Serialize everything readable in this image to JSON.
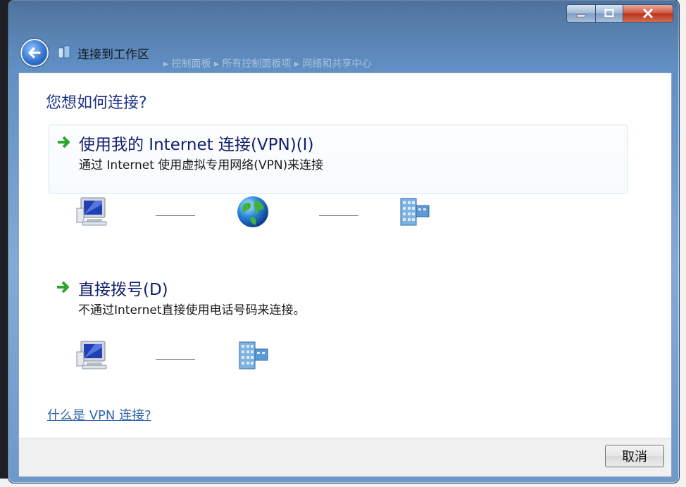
{
  "window": {
    "title": "连接到工作区",
    "background_breadcrumb": "▸ 控制面板 ▸ 所有控制面板项 ▸ 网络和共享中心"
  },
  "content": {
    "heading": "您想如何连接?",
    "options": [
      {
        "title": "使用我的 Internet 连接(VPN)(I)",
        "description": "通过 Internet 使用虚拟专用网络(VPN)来连接",
        "diagram": [
          "computer-icon",
          "globe-icon",
          "building-icon"
        ]
      },
      {
        "title": "直接拨号(D)",
        "description": "不通过Internet直接使用电话号码来连接。",
        "diagram": [
          "computer-icon",
          "building-icon"
        ]
      }
    ],
    "help_link": "什么是 VPN 连接?"
  },
  "footer": {
    "cancel_label": "取消"
  },
  "colors": {
    "heading": "#1e3287",
    "link": "#3366aa",
    "arrow": "#2fa52f"
  }
}
